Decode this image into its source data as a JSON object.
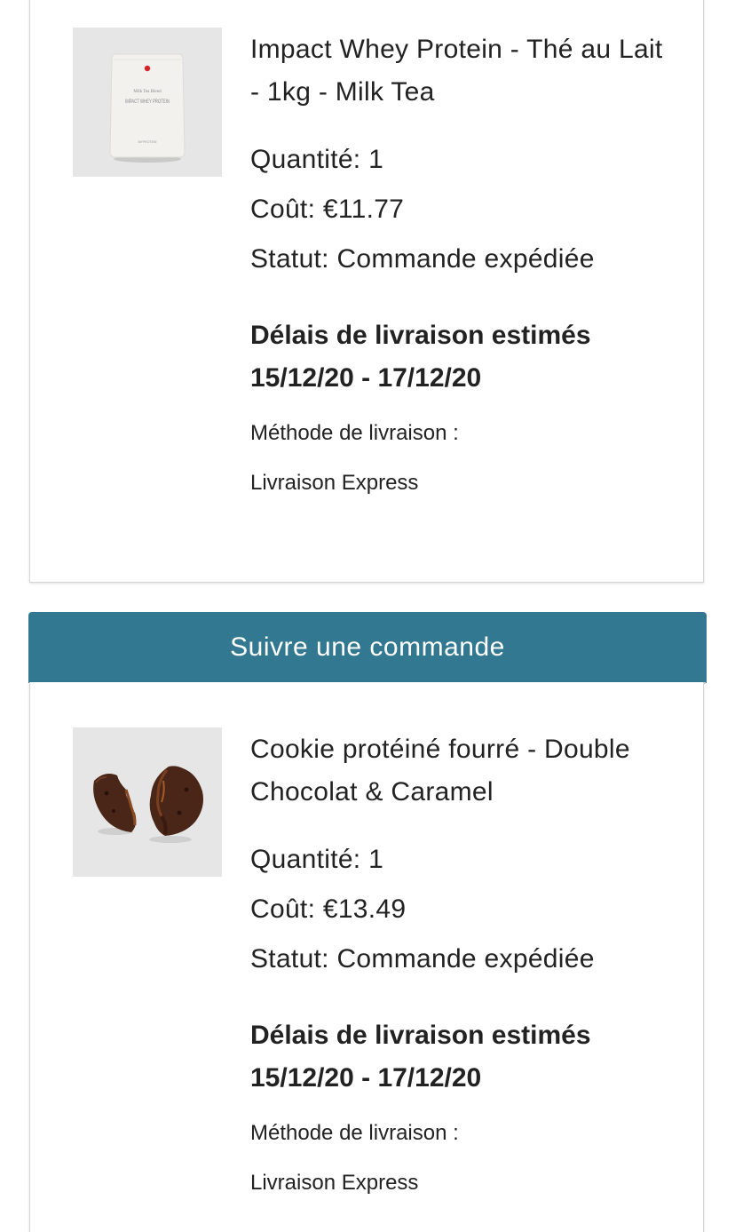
{
  "orders": [
    {
      "image_icon": "whey-protein-bag-image",
      "title": "Impact Whey Protein - Thé au Lait - 1kg - Milk Tea",
      "quantity": "Quantité: 1",
      "cost": "Coût: €11.77",
      "status": "Statut: Commande expédiée",
      "delivery_head": "Délais de livraison estimés",
      "delivery_range": "15/12/20 - 17/12/20",
      "method_label": "Méthode de livraison :",
      "method_value": "Livraison Express",
      "bag_label_small": "Milk Tea Blend",
      "bag_label": "IMPACT WHEY PROTEIN",
      "bag_brand": "MYPROTEIN"
    },
    {
      "image_icon": "cookie-image",
      "title": "Cookie protéiné fourré - Double Chocolat & Caramel",
      "quantity": "Quantité: 1",
      "cost": "Coût: €13.49",
      "status": "Statut: Commande expédiée",
      "delivery_head": "Délais de livraison estimés",
      "delivery_range": "15/12/20 - 17/12/20",
      "method_label": "Méthode de livraison :",
      "method_value": "Livraison Express"
    }
  ],
  "track_button": "Suivre une commande",
  "colors": {
    "accent": "#317890",
    "text": "#222222",
    "thumb_bg": "#e6e6e6"
  }
}
